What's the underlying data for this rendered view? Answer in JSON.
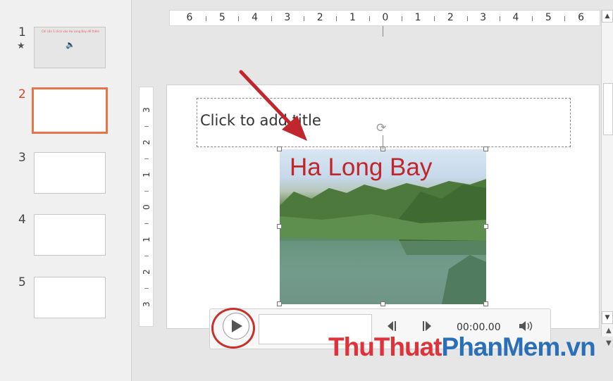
{
  "thumbnails": [
    {
      "number": "1",
      "text": "Chỉ cần 1 click vào Ha Long Bay để thêm",
      "has_star": true,
      "star": "★"
    },
    {
      "number": "2"
    },
    {
      "number": "3"
    },
    {
      "number": "4"
    },
    {
      "number": "5"
    }
  ],
  "ruler": {
    "horizontal": [
      "6",
      "5",
      "4",
      "3",
      "2",
      "1",
      "0",
      "1",
      "2",
      "3",
      "4",
      "5",
      "6"
    ],
    "vertical": [
      "3",
      "2",
      "1",
      "0",
      "1",
      "2",
      "3"
    ]
  },
  "slide": {
    "title_placeholder": "Click to add title",
    "video_title": "Ha Long Bay"
  },
  "media_controls": {
    "time": "00:00.00",
    "play_icon": "play-icon",
    "back_icon": "step-back-icon",
    "forward_icon": "step-forward-icon",
    "volume_icon": "volume-icon"
  },
  "annotations": {
    "arrow_color": "#c0262b",
    "circle_color": "#c8302c"
  },
  "watermark": {
    "part1": "ThuThuat",
    "part2": "PhanMem.vn"
  },
  "colors": {
    "active_slide_border": "#e5764b",
    "video_title": "#c0262b"
  }
}
